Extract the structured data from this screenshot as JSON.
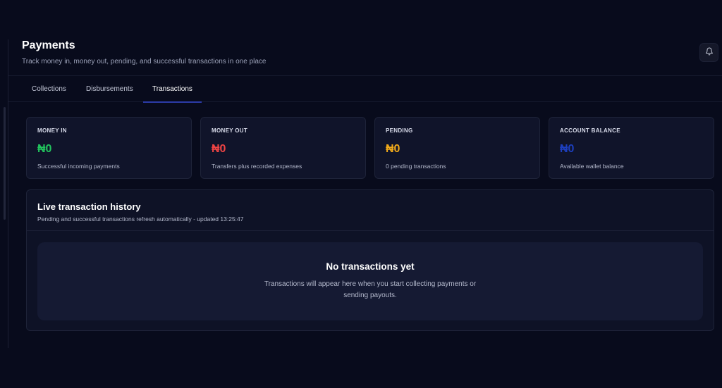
{
  "header": {
    "title": "Payments",
    "subtitle": "Track money in, money out, pending, and successful transactions in one place",
    "notifications_icon": "bell-icon"
  },
  "tabs": [
    {
      "label": "Collections",
      "active": false
    },
    {
      "label": "Disbursements",
      "active": false
    },
    {
      "label": "Transactions",
      "active": true
    }
  ],
  "colors": {
    "accent": "#2c3ca8",
    "money_in": "#22c55e",
    "money_out": "#ef4444",
    "pending": "#f0a91a",
    "balance": "#1d3fbf"
  },
  "cards": [
    {
      "label": "MONEY IN",
      "value": "₦0",
      "note": "Successful incoming payments"
    },
    {
      "label": "MONEY OUT",
      "value": "₦0",
      "note": "Transfers plus recorded expenses"
    },
    {
      "label": "PENDING",
      "value": "₦0",
      "note": "0 pending transactions"
    },
    {
      "label": "ACCOUNT BALANCE",
      "value": "₦0",
      "note": "Available wallet balance"
    }
  ],
  "history": {
    "title": "Live transaction history",
    "subtitle": "Pending and successful transactions refresh automatically - updated 13:25:47",
    "empty_title": "No transactions yet",
    "empty_text": "Transactions will appear here when you start collecting payments or sending payouts."
  }
}
